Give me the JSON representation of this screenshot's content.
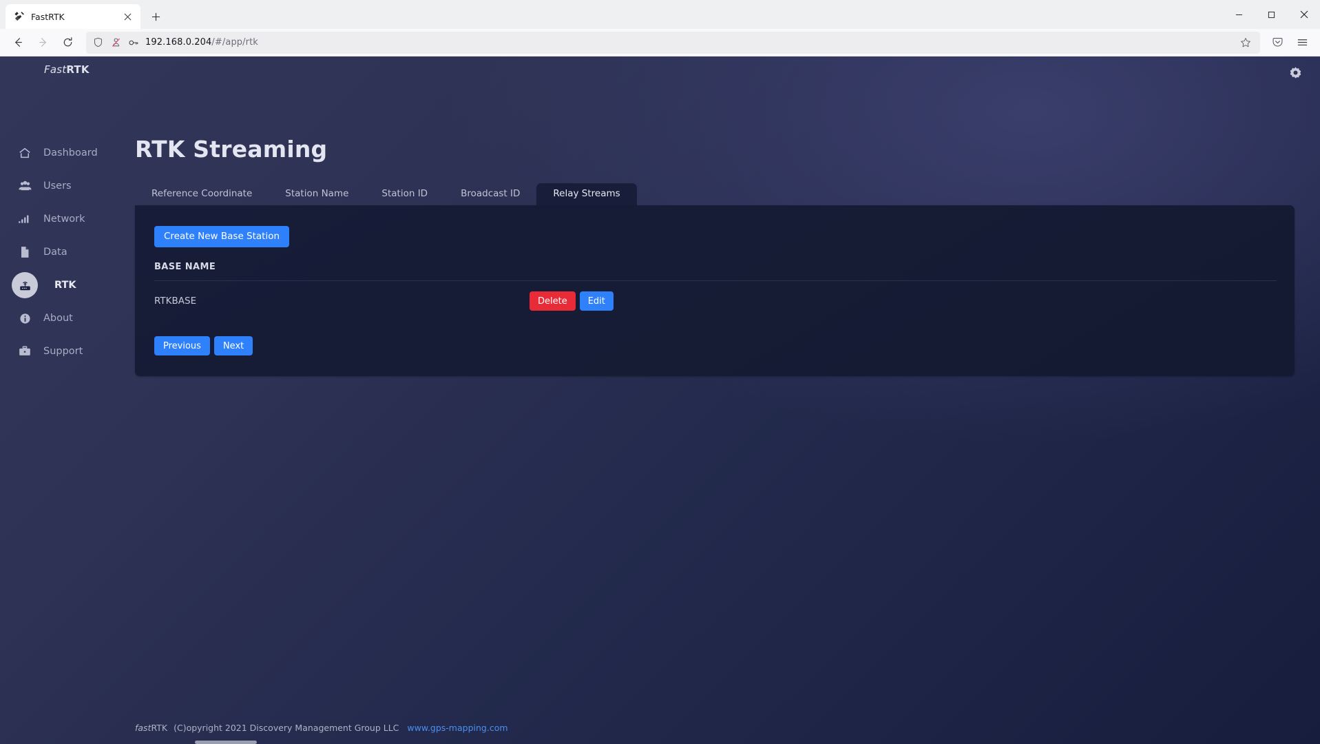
{
  "browser": {
    "tab": {
      "title": "FastRTK",
      "favicon": "satellite-icon",
      "close": "×"
    },
    "newtab_label": "+",
    "window_controls": {
      "minimize": "minimize-icon",
      "maximize": "maximize-icon",
      "close": "close-icon"
    },
    "nav": {
      "back": "back-arrow-icon",
      "forward": "forward-arrow-icon",
      "reload": "reload-icon"
    },
    "url": {
      "host": "192.168.0.204",
      "path": "/#/app/rtk"
    },
    "url_icons": [
      "shield-icon",
      "tracking-protection-off-icon",
      "key-icon"
    ],
    "bookmark": "star-icon",
    "right_icons": [
      "save-to-pocket-icon",
      "application-menu-icon"
    ]
  },
  "app": {
    "brand": {
      "first": "Fast",
      "second": "RTK"
    },
    "settings_icon": "gear-icon",
    "sidebar": {
      "items": [
        {
          "label": "Dashboard",
          "icon": "home-icon",
          "active": false
        },
        {
          "label": "Users",
          "icon": "users-icon",
          "active": false
        },
        {
          "label": "Network",
          "icon": "signal-bars-icon",
          "active": false
        },
        {
          "label": "Data",
          "icon": "file-icon",
          "active": false
        },
        {
          "label": "RTK",
          "icon": "router-icon",
          "active": true
        },
        {
          "label": "About",
          "icon": "info-circle-icon",
          "active": false
        },
        {
          "label": "Support",
          "icon": "briefcase-icon",
          "active": false
        }
      ]
    },
    "page_title": "RTK Streaming",
    "tabs": [
      {
        "label": "Reference Coordinate",
        "active": false
      },
      {
        "label": "Station Name",
        "active": false
      },
      {
        "label": "Station ID",
        "active": false
      },
      {
        "label": "Broadcast ID",
        "active": false
      },
      {
        "label": "Relay Streams",
        "active": true
      }
    ],
    "panel": {
      "create_button": "Create New Base Station",
      "table": {
        "columns": [
          "BASE NAME"
        ],
        "rows": [
          {
            "name": "RTKBASE",
            "delete_label": "Delete",
            "edit_label": "Edit"
          }
        ]
      },
      "pager": {
        "previous": "Previous",
        "next": "Next"
      }
    },
    "footer": {
      "brand_italic": "fast",
      "brand_rest": "RTK",
      "copyright": "(C)opyright 2021 Discovery Management Group LLC",
      "link": "www.gps-mapping.com"
    },
    "colors": {
      "primary": "#2f80fb",
      "danger": "#e82b37",
      "panel_bg": "#171d38",
      "app_bg": "#2e3254",
      "link": "#4a8ff0"
    }
  }
}
